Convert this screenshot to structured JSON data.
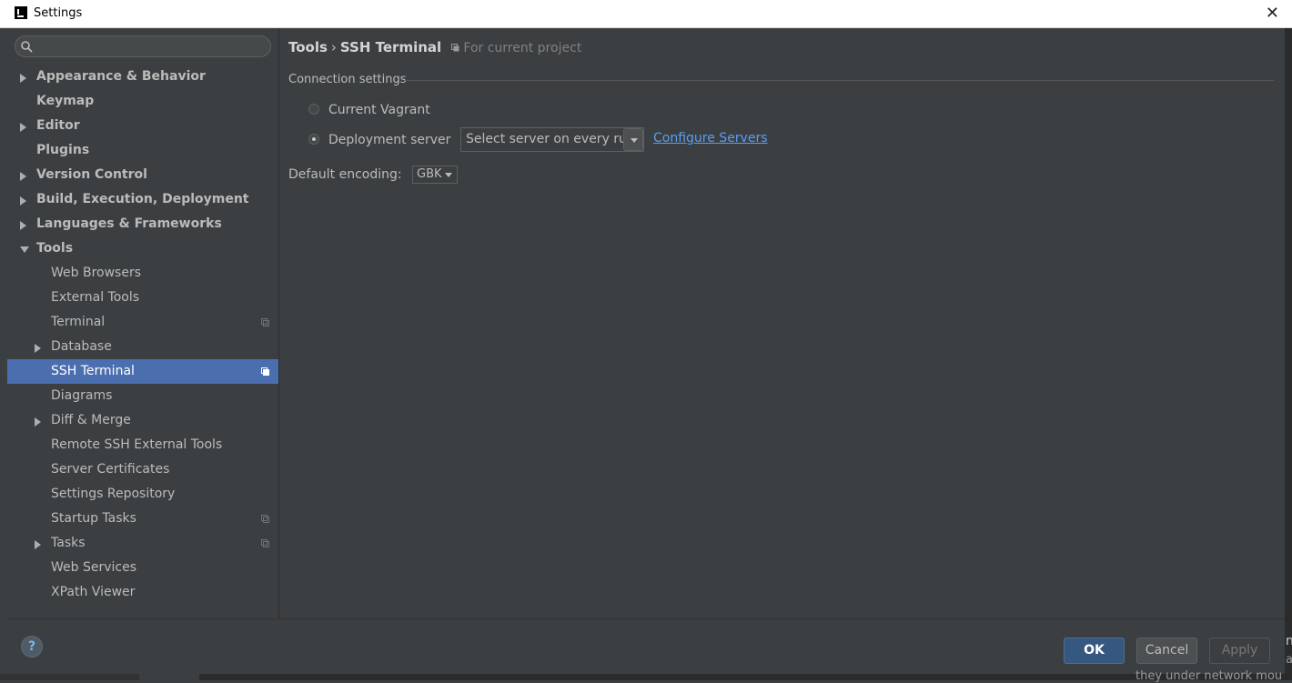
{
  "window": {
    "title": "Settings"
  },
  "search": {
    "value": "",
    "placeholder": ""
  },
  "tree": {
    "items": [
      {
        "label": "Appearance & Behavior",
        "level": 0,
        "bold": true,
        "arrow": "right"
      },
      {
        "label": "Keymap",
        "level": 0,
        "bold": true,
        "arrow": ""
      },
      {
        "label": "Editor",
        "level": 0,
        "bold": true,
        "arrow": "right"
      },
      {
        "label": "Plugins",
        "level": 0,
        "bold": true,
        "arrow": ""
      },
      {
        "label": "Version Control",
        "level": 0,
        "bold": true,
        "arrow": "right"
      },
      {
        "label": "Build, Execution, Deployment",
        "level": 0,
        "bold": true,
        "arrow": "right"
      },
      {
        "label": "Languages & Frameworks",
        "level": 0,
        "bold": true,
        "arrow": "right"
      },
      {
        "label": "Tools",
        "level": 0,
        "bold": true,
        "arrow": "down"
      },
      {
        "label": "Web Browsers",
        "level": 1,
        "bold": false,
        "arrow": ""
      },
      {
        "label": "External Tools",
        "level": 1,
        "bold": false,
        "arrow": ""
      },
      {
        "label": "Terminal",
        "level": 1,
        "bold": false,
        "arrow": "",
        "project": true
      },
      {
        "label": "Database",
        "level": 1,
        "bold": false,
        "arrow": "right"
      },
      {
        "label": "SSH Terminal",
        "level": 1,
        "bold": false,
        "arrow": "",
        "project": true,
        "selected": true
      },
      {
        "label": "Diagrams",
        "level": 1,
        "bold": false,
        "arrow": ""
      },
      {
        "label": "Diff & Merge",
        "level": 1,
        "bold": false,
        "arrow": "right"
      },
      {
        "label": "Remote SSH External Tools",
        "level": 1,
        "bold": false,
        "arrow": ""
      },
      {
        "label": "Server Certificates",
        "level": 1,
        "bold": false,
        "arrow": ""
      },
      {
        "label": "Settings Repository",
        "level": 1,
        "bold": false,
        "arrow": ""
      },
      {
        "label": "Startup Tasks",
        "level": 1,
        "bold": false,
        "arrow": "",
        "project": true
      },
      {
        "label": "Tasks",
        "level": 1,
        "bold": false,
        "arrow": "right",
        "project": true
      },
      {
        "label": "Web Services",
        "level": 1,
        "bold": false,
        "arrow": ""
      },
      {
        "label": "XPath Viewer",
        "level": 1,
        "bold": false,
        "arrow": ""
      }
    ]
  },
  "breadcrumb": {
    "parent": "Tools",
    "separator": "›",
    "current": "SSH Terminal",
    "scope": "For current project"
  },
  "connection": {
    "title": "Connection settings",
    "option_vagrant": "Current Vagrant",
    "option_deployment": "Deployment server",
    "selected": "deployment",
    "server_select": "Select server on every run",
    "configure_link": "Configure Servers"
  },
  "encoding": {
    "label": "Default encoding:",
    "value": "GBK"
  },
  "buttons": {
    "help": "?",
    "ok": "OK",
    "cancel": "Cancel",
    "apply": "Apply"
  },
  "background": {
    "text1": "n",
    "text2": "a",
    "text3": "they under network mou"
  },
  "colors": {
    "selection": "#4b6eaf",
    "link": "#589df6",
    "ok_button": "#365880",
    "panel": "#3c3f41"
  }
}
